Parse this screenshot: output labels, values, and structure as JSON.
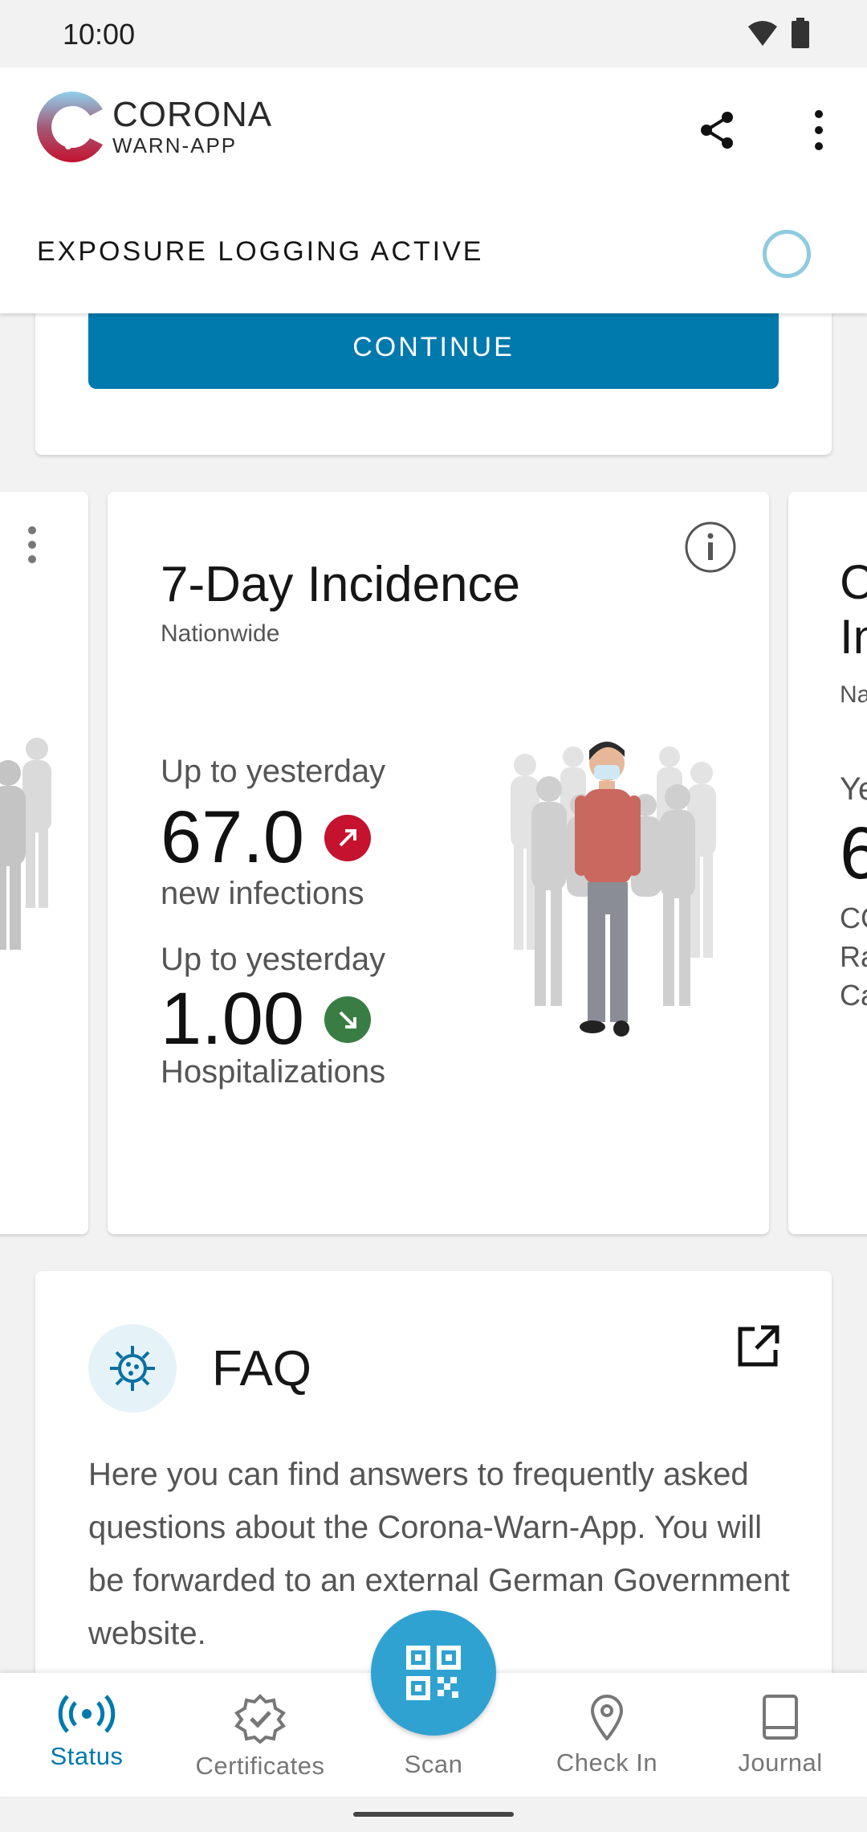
{
  "status_bar": {
    "time": "10:00"
  },
  "header": {
    "logo_line1": "CORONA",
    "logo_line2": "WARN-APP",
    "exposure_status": "EXPOSURE LOGGING ACTIVE"
  },
  "top_card": {
    "button_label": "CONTINUE"
  },
  "incidence_card": {
    "title": "7-Day Incidence",
    "subtitle": "Nationwide",
    "stats": [
      {
        "label": "Up to yesterday",
        "value": "67.0",
        "description": "new infections",
        "trend": "up",
        "trend_color": "#c4122f"
      },
      {
        "label": "Up to yesterday",
        "value": "1.00",
        "description": "Hospitalizations",
        "trend": "down",
        "trend_color": "#3a7d44"
      }
    ]
  },
  "right_peek": {
    "line1": "C",
    "line2": "In",
    "line3": "Na",
    "line4": "Ye",
    "line5": "6",
    "line6": "CC",
    "line7": "Ra",
    "line8": "Ca"
  },
  "faq": {
    "title": "FAQ",
    "body": "Here you can find answers to frequently asked questions about the Corona-Warn-App. You will be forwarded to an external German Government website."
  },
  "nav": {
    "items": [
      {
        "label": "Status",
        "icon": "broadcast-icon",
        "active": true
      },
      {
        "label": "Certificates",
        "icon": "badge-check-icon",
        "active": false
      },
      {
        "label": "Scan",
        "icon": "qr-code-icon",
        "active": false
      },
      {
        "label": "Check In",
        "icon": "location-pin-icon",
        "active": false
      },
      {
        "label": "Journal",
        "icon": "book-icon",
        "active": false
      }
    ]
  },
  "colors": {
    "accent": "#0079ad",
    "fab": "#2fa2d1",
    "up": "#c4122f",
    "down": "#3a7d44"
  }
}
